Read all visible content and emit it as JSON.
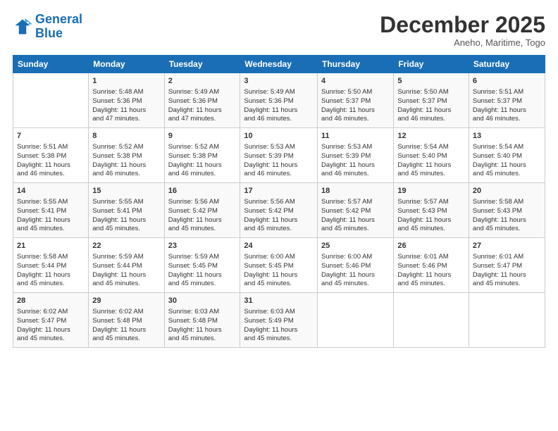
{
  "logo": {
    "line1": "General",
    "line2": "Blue"
  },
  "title": "December 2025",
  "subtitle": "Aneho, Maritime, Togo",
  "days_header": [
    "Sunday",
    "Monday",
    "Tuesday",
    "Wednesday",
    "Thursday",
    "Friday",
    "Saturday"
  ],
  "weeks": [
    [
      {
        "day": "",
        "info": ""
      },
      {
        "day": "1",
        "info": "Sunrise: 5:48 AM\nSunset: 5:36 PM\nDaylight: 11 hours\nand 47 minutes."
      },
      {
        "day": "2",
        "info": "Sunrise: 5:49 AM\nSunset: 5:36 PM\nDaylight: 11 hours\nand 47 minutes."
      },
      {
        "day": "3",
        "info": "Sunrise: 5:49 AM\nSunset: 5:36 PM\nDaylight: 11 hours\nand 46 minutes."
      },
      {
        "day": "4",
        "info": "Sunrise: 5:50 AM\nSunset: 5:37 PM\nDaylight: 11 hours\nand 46 minutes."
      },
      {
        "day": "5",
        "info": "Sunrise: 5:50 AM\nSunset: 5:37 PM\nDaylight: 11 hours\nand 46 minutes."
      },
      {
        "day": "6",
        "info": "Sunrise: 5:51 AM\nSunset: 5:37 PM\nDaylight: 11 hours\nand 46 minutes."
      }
    ],
    [
      {
        "day": "7",
        "info": "Sunrise: 5:51 AM\nSunset: 5:38 PM\nDaylight: 11 hours\nand 46 minutes."
      },
      {
        "day": "8",
        "info": "Sunrise: 5:52 AM\nSunset: 5:38 PM\nDaylight: 11 hours\nand 46 minutes."
      },
      {
        "day": "9",
        "info": "Sunrise: 5:52 AM\nSunset: 5:38 PM\nDaylight: 11 hours\nand 46 minutes."
      },
      {
        "day": "10",
        "info": "Sunrise: 5:53 AM\nSunset: 5:39 PM\nDaylight: 11 hours\nand 46 minutes."
      },
      {
        "day": "11",
        "info": "Sunrise: 5:53 AM\nSunset: 5:39 PM\nDaylight: 11 hours\nand 46 minutes."
      },
      {
        "day": "12",
        "info": "Sunrise: 5:54 AM\nSunset: 5:40 PM\nDaylight: 11 hours\nand 45 minutes."
      },
      {
        "day": "13",
        "info": "Sunrise: 5:54 AM\nSunset: 5:40 PM\nDaylight: 11 hours\nand 45 minutes."
      }
    ],
    [
      {
        "day": "14",
        "info": "Sunrise: 5:55 AM\nSunset: 5:41 PM\nDaylight: 11 hours\nand 45 minutes."
      },
      {
        "day": "15",
        "info": "Sunrise: 5:55 AM\nSunset: 5:41 PM\nDaylight: 11 hours\nand 45 minutes."
      },
      {
        "day": "16",
        "info": "Sunrise: 5:56 AM\nSunset: 5:42 PM\nDaylight: 11 hours\nand 45 minutes."
      },
      {
        "day": "17",
        "info": "Sunrise: 5:56 AM\nSunset: 5:42 PM\nDaylight: 11 hours\nand 45 minutes."
      },
      {
        "day": "18",
        "info": "Sunrise: 5:57 AM\nSunset: 5:42 PM\nDaylight: 11 hours\nand 45 minutes."
      },
      {
        "day": "19",
        "info": "Sunrise: 5:57 AM\nSunset: 5:43 PM\nDaylight: 11 hours\nand 45 minutes."
      },
      {
        "day": "20",
        "info": "Sunrise: 5:58 AM\nSunset: 5:43 PM\nDaylight: 11 hours\nand 45 minutes."
      }
    ],
    [
      {
        "day": "21",
        "info": "Sunrise: 5:58 AM\nSunset: 5:44 PM\nDaylight: 11 hours\nand 45 minutes."
      },
      {
        "day": "22",
        "info": "Sunrise: 5:59 AM\nSunset: 5:44 PM\nDaylight: 11 hours\nand 45 minutes."
      },
      {
        "day": "23",
        "info": "Sunrise: 5:59 AM\nSunset: 5:45 PM\nDaylight: 11 hours\nand 45 minutes."
      },
      {
        "day": "24",
        "info": "Sunrise: 6:00 AM\nSunset: 5:45 PM\nDaylight: 11 hours\nand 45 minutes."
      },
      {
        "day": "25",
        "info": "Sunrise: 6:00 AM\nSunset: 5:46 PM\nDaylight: 11 hours\nand 45 minutes."
      },
      {
        "day": "26",
        "info": "Sunrise: 6:01 AM\nSunset: 5:46 PM\nDaylight: 11 hours\nand 45 minutes."
      },
      {
        "day": "27",
        "info": "Sunrise: 6:01 AM\nSunset: 5:47 PM\nDaylight: 11 hours\nand 45 minutes."
      }
    ],
    [
      {
        "day": "28",
        "info": "Sunrise: 6:02 AM\nSunset: 5:47 PM\nDaylight: 11 hours\nand 45 minutes."
      },
      {
        "day": "29",
        "info": "Sunrise: 6:02 AM\nSunset: 5:48 PM\nDaylight: 11 hours\nand 45 minutes."
      },
      {
        "day": "30",
        "info": "Sunrise: 6:03 AM\nSunset: 5:48 PM\nDaylight: 11 hours\nand 45 minutes."
      },
      {
        "day": "31",
        "info": "Sunrise: 6:03 AM\nSunset: 5:49 PM\nDaylight: 11 hours\nand 45 minutes."
      },
      {
        "day": "",
        "info": ""
      },
      {
        "day": "",
        "info": ""
      },
      {
        "day": "",
        "info": ""
      }
    ]
  ]
}
